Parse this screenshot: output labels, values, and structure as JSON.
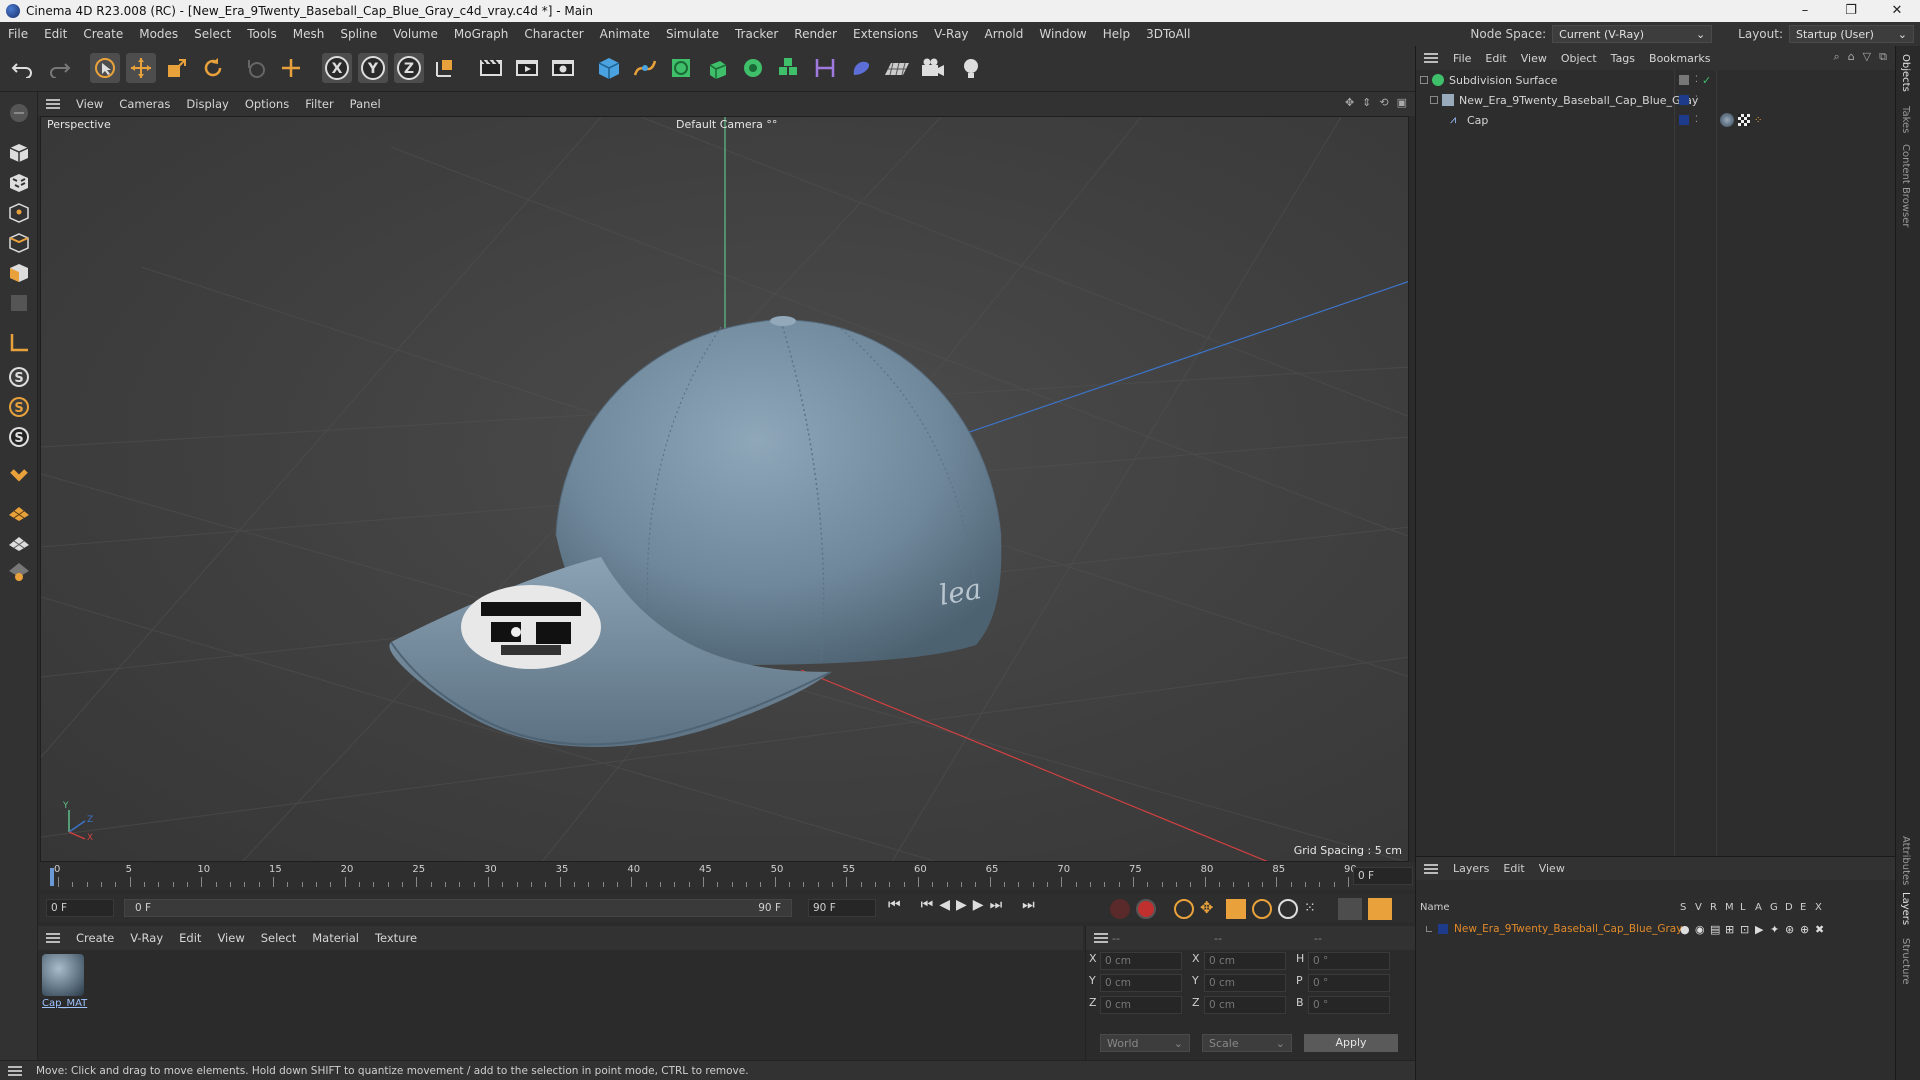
{
  "window": {
    "title": "Cinema 4D R23.008 (RC) - [New_Era_9Twenty_Baseball_Cap_Blue_Gray_c4d_vray.c4d *] - Main",
    "controls": [
      "–",
      "❐",
      "✕"
    ]
  },
  "menu": [
    "File",
    "Edit",
    "Create",
    "Modes",
    "Select",
    "Tools",
    "Mesh",
    "Spline",
    "Volume",
    "MoGraph",
    "Character",
    "Animate",
    "Simulate",
    "Tracker",
    "Render",
    "Extensions",
    "V-Ray",
    "Arnold",
    "Window",
    "Help",
    "3DToAll"
  ],
  "node_space": {
    "label": "Node Space:",
    "value": "Current (V-Ray)"
  },
  "layout": {
    "label": "Layout:",
    "value": "Startup (User)"
  },
  "viewport": {
    "menu": [
      "View",
      "Cameras",
      "Display",
      "Options",
      "Filter",
      "Panel"
    ],
    "label": "Perspective",
    "camera": "Default Camera °°",
    "grid_spacing": "Grid Spacing : 5 cm",
    "axis": {
      "y": "Y",
      "z": "Z",
      "x": "X"
    },
    "colors": {
      "x_axis": "#d04040",
      "y_axis": "#5ec08a",
      "z_axis": "#3c74c8",
      "cap": "#7a93a6"
    }
  },
  "timeline": {
    "ticks": [
      "0",
      "5",
      "10",
      "15",
      "20",
      "25",
      "30",
      "35",
      "40",
      "45",
      "50",
      "55",
      "60",
      "65",
      "70",
      "75",
      "80",
      "85",
      "90"
    ],
    "end_field": "0 F"
  },
  "transport": {
    "start": "0 F",
    "range_start": "0 F",
    "range_end": "90 F",
    "end": "90 F"
  },
  "material_manager": {
    "menu": [
      "Create",
      "V-Ray",
      "Edit",
      "View",
      "Select",
      "Material",
      "Texture"
    ],
    "material_name": "Cap_MAT"
  },
  "coordinates": {
    "headers": [
      "--",
      "--",
      "--"
    ],
    "rows": [
      {
        "a": "X",
        "av": "0 cm",
        "b": "X",
        "bv": "0 cm",
        "c": "H",
        "cv": "0 °"
      },
      {
        "a": "Y",
        "av": "0 cm",
        "b": "Y",
        "bv": "0 cm",
        "c": "P",
        "cv": "0 °"
      },
      {
        "a": "Z",
        "av": "0 cm",
        "b": "Z",
        "bv": "0 cm",
        "c": "B",
        "cv": "0 °"
      }
    ],
    "mode": "World",
    "type": "Scale",
    "apply": "Apply"
  },
  "status": "Move: Click and drag to move elements. Hold down SHIFT to quantize movement / add to the selection in point mode, CTRL to remove.",
  "object_manager": {
    "menu": [
      "File",
      "Edit",
      "View",
      "Object",
      "Tags",
      "Bookmarks"
    ],
    "objects": [
      {
        "name": "Subdivision Surface"
      },
      {
        "name": "New_Era_9Twenty_Baseball_Cap_Blue_Gray"
      },
      {
        "name": "Cap"
      }
    ]
  },
  "layers": {
    "menu": [
      "Layers",
      "Edit",
      "View"
    ],
    "name_header": "Name",
    "flags": [
      "S",
      "V",
      "R",
      "M",
      "L",
      "A",
      "G",
      "D",
      "E",
      "X"
    ],
    "items": [
      {
        "name": "New_Era_9Twenty_Baseball_Cap_Blue_Gray",
        "color": "#e08a2a"
      }
    ]
  },
  "side_tabs": [
    "Objects",
    "Takes",
    "Content Browser",
    "Attributes",
    "Layers",
    "Structure"
  ]
}
